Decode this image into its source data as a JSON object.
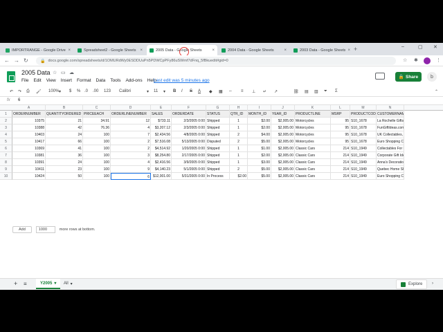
{
  "browser": {
    "tabs": [
      {
        "title": "IMPORTRANGE - Google Drive",
        "icon": "drive-icon",
        "active": false
      },
      {
        "title": "Spreadsheet2 - Google Sheets",
        "icon": "sheets-icon",
        "active": false
      },
      {
        "title": "2005 Data - Google Sheets",
        "icon": "sheets-icon",
        "active": true
      },
      {
        "title": "2004 Data - Google Sheets",
        "icon": "sheets-icon",
        "active": false
      },
      {
        "title": "2003 Data - Google Sheets",
        "icon": "sheets-icon",
        "active": false
      }
    ],
    "url": "docs.google.com/spreadsheets/d/1OMURdWy0ESDDUuPn5PDWCpPFy86uSWmf7dFnq_5fBkuedit#gid=0"
  },
  "doc": {
    "title": "2005 Data",
    "menus": [
      "File",
      "Edit",
      "View",
      "Insert",
      "Format",
      "Data",
      "Tools",
      "Add-ons",
      "Help"
    ],
    "last_edit": "Last edit was 5 minutes ago",
    "share_label": "Share",
    "account_initial": "b"
  },
  "toolbar": {
    "zoom": "100%",
    "currency": "$",
    "percent": "%",
    "dec_less": ".0",
    "dec_more": ".00",
    "format": "123",
    "font": "Calibri",
    "font_size": "11",
    "bold": "B",
    "italic": "I",
    "strike": "S",
    "text_color": "A"
  },
  "formula_bar": {
    "label": "fx",
    "value": "6"
  },
  "grid": {
    "columns": [
      "A",
      "B",
      "C",
      "D",
      "E",
      "F",
      "G",
      "H",
      "I",
      "J",
      "K",
      "L",
      "M",
      "N"
    ],
    "headers": [
      "ORDERNUMBER",
      "QUANTITYORDERED",
      "PRICEEACH",
      "ORDERLINENUMBER",
      "SALES",
      "ORDERDATE",
      "STATUS",
      "QTR_ID",
      "MONTH_ID",
      "YEAR_ID",
      "PRODUCTLINE",
      "MSRP",
      "PRODUCTCODE",
      "CUSTOMERNAME"
    ],
    "rows": [
      [
        "10375",
        "21",
        "34.91",
        "12",
        "$733.11",
        "2/3/2005 0:00",
        "Shipped",
        "1",
        "$2.00",
        "$2,005.00",
        "Motorcycles",
        "95",
        "S10_1678",
        "La Rochelle Gifts"
      ],
      [
        "10388",
        "42",
        "76.36",
        "4",
        "$3,207.12",
        "2/3/2005 0:00",
        "Shipped",
        "1",
        "$2.00",
        "$2,005.00",
        "Motorcycles",
        "95",
        "S10_1678",
        "FunGiftIdeas.com"
      ],
      [
        "10403",
        "24",
        "100",
        "7",
        "$2,434.56",
        "4/8/2005 0:00",
        "Shipped",
        "2",
        "$4.00",
        "$2,005.00",
        "Motorcycles",
        "95",
        "S10_1678",
        "UK Collectables, Ltd."
      ],
      [
        "10417",
        "66",
        "100",
        "2",
        "$7,516.08",
        "5/13/2005 0:00",
        "Disputed",
        "2",
        "$5.00",
        "$2,005.00",
        "Motorcycles",
        "95",
        "S10_1678",
        "Euro Shopping Channel"
      ],
      [
        "10369",
        "41",
        "100",
        "2",
        "$4,514.92",
        "1/20/2005 0:00",
        "Shipped",
        "1",
        "$1.00",
        "$2,005.00",
        "Classic Cars",
        "214",
        "S10_1949",
        "Collectables For Less Inc."
      ],
      [
        "10381",
        "36",
        "100",
        "3",
        "$8,254.80",
        "2/17/2005 0:00",
        "Shipped",
        "1",
        "$2.00",
        "$2,005.00",
        "Classic Cars",
        "214",
        "S10_1949",
        "Corporate Gift Ideas Co."
      ],
      [
        "10391",
        "24",
        "100",
        "4",
        "$2,416.56",
        "3/9/2005 0:00",
        "Shipped",
        "1",
        "$3.00",
        "$2,005.00",
        "Classic Cars",
        "214",
        "S10_1949",
        "Anna's Decorations, Ltd"
      ],
      [
        "10411",
        "23",
        "100",
        "9",
        "$4,140.23",
        "5/1/2005 0:00",
        "Shipped",
        "2",
        "$5.00",
        "$2,005.00",
        "Classic Cars",
        "214",
        "S10_1949",
        "Quebec Home Shopping Network"
      ],
      [
        "10424",
        "50",
        "100",
        "6",
        "$12,001.00",
        "5/31/2005 0:00",
        "In Process",
        "$2.00",
        "$5.00",
        "$2,005.00",
        "Classic Cars",
        "214",
        "S10_1949",
        "Euro Shopping Channel"
      ]
    ],
    "row_numbers": [
      "1",
      "2",
      "3",
      "4",
      "5",
      "6",
      "7",
      "8",
      "9",
      "10"
    ],
    "add_label": "Add",
    "add_count": "1000",
    "add_suffix": "more rows at bottom."
  },
  "sheet_tabs": {
    "add": "+",
    "list": "≡",
    "tabs": [
      {
        "label": "Y2005",
        "active": true
      },
      {
        "label": "All",
        "active": false
      }
    ],
    "explore_label": "Explore"
  },
  "colors": {
    "accent": "#188038",
    "selection": "#1a73e8",
    "cursor": "#e53935"
  }
}
